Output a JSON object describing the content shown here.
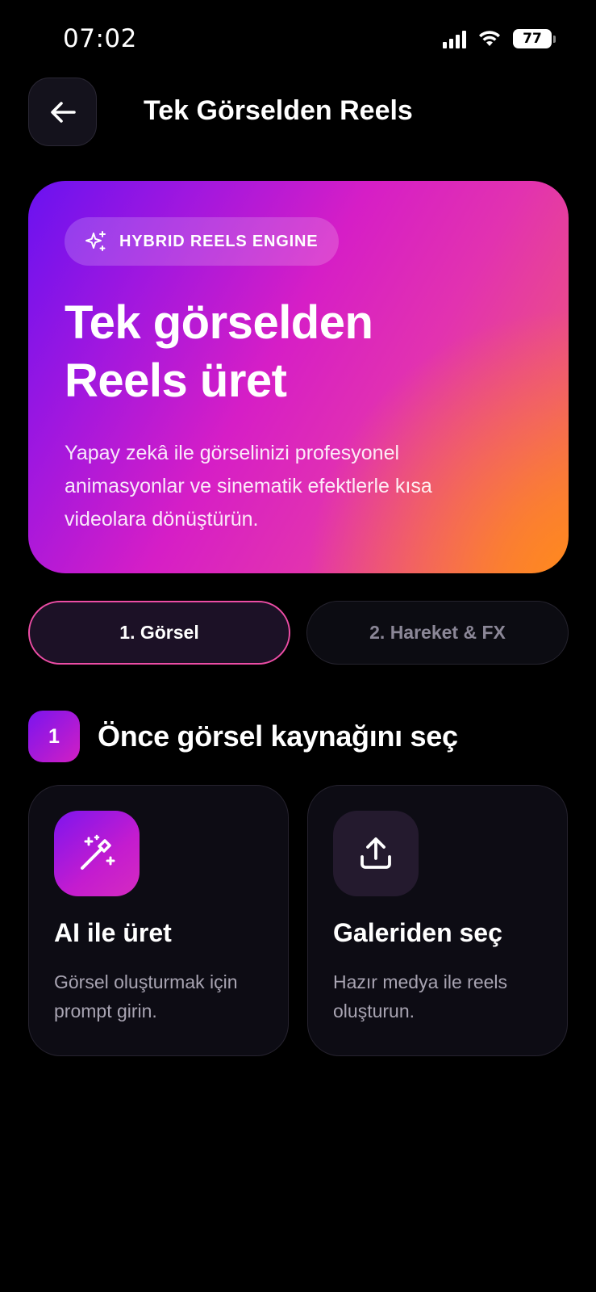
{
  "status": {
    "time": "07:02",
    "battery": "77",
    "icons": [
      "signal-icon",
      "wifi-icon",
      "battery-icon"
    ]
  },
  "header": {
    "title": "Tek Görselden Reels",
    "back_icon": "arrow-left-icon"
  },
  "hero": {
    "badge_icon": "sparkles-icon",
    "badge": "HYBRID REELS ENGINE",
    "title_line1": "Tek görselden",
    "title_line2": "Reels üret",
    "description": "Yapay zekâ ile görselinizi profesyonel animasyonlar ve sinematik efektlerle kısa videolara dönüştürün."
  },
  "steps": [
    {
      "label": "1. Görsel",
      "active": true
    },
    {
      "label": "2. Hareket & FX",
      "active": false
    }
  ],
  "section": {
    "number": "1",
    "title": "Önce görsel kaynağını seç"
  },
  "sources": [
    {
      "icon": "magic-wand-icon",
      "title": "AI ile üret",
      "description": "Görsel oluşturmak için prompt girin."
    },
    {
      "icon": "upload-icon",
      "title": "Galeriden seç",
      "description": "Hazır medya ile reels oluşturun."
    }
  ],
  "colors": {
    "background": "#000000",
    "accent_pink": "#ec4da5",
    "accent_purple": "#7a14ef",
    "card_bg": "#0d0c14",
    "muted_text": "#a8a4b2",
    "hero_orange": "#ff8a1d"
  }
}
